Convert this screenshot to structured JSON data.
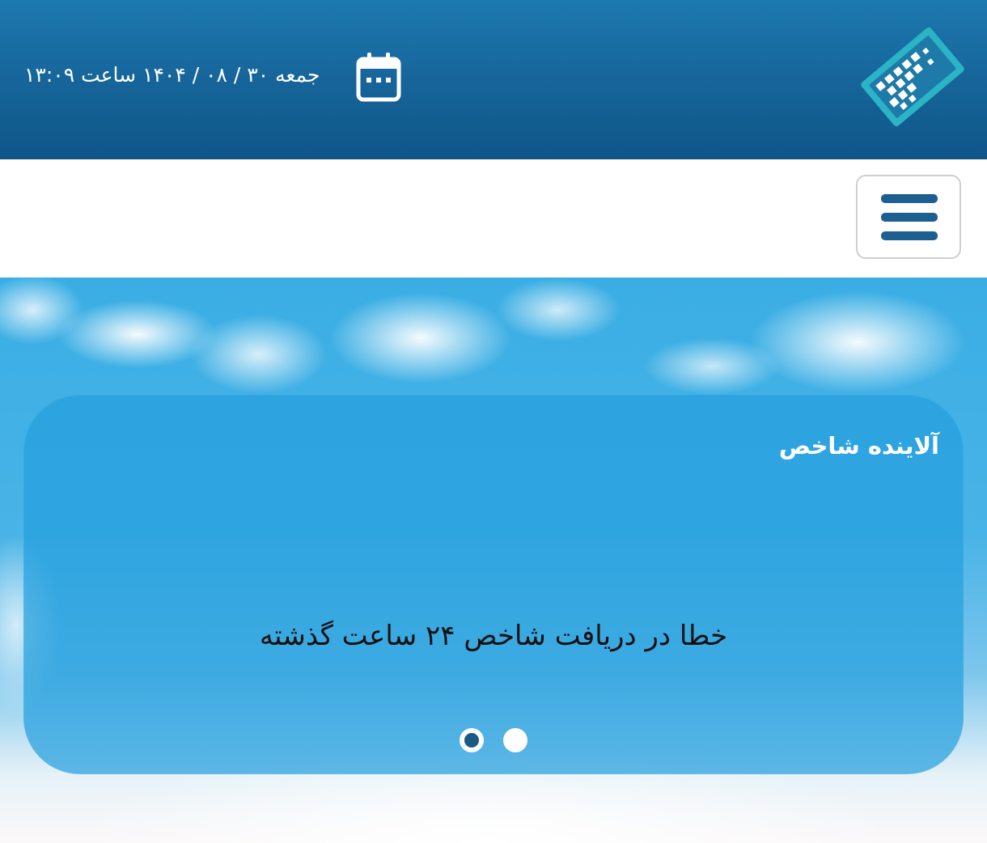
{
  "header": {
    "datetime_text": "جمعه ۳۰ / ۰۸ / ۱۴۰۴ ساعت ۱۳:۰۹",
    "calendar_icon": "calendar-icon",
    "logo_icon": "pixel-card-logo"
  },
  "nav": {
    "menu_icon": "hamburger-menu-icon"
  },
  "pollutant_card": {
    "title": "آلاینده شاخص",
    "message": "خطا در دریافت شاخص ۲۴ ساعت گذشته",
    "carousel": {
      "slide_count": 2,
      "active_index": 0
    }
  },
  "colors": {
    "header_bg": "#16659a",
    "menu_icon": "#1c5f91",
    "card_bg": "#26a0de",
    "active_dot": "#1b5a83"
  }
}
